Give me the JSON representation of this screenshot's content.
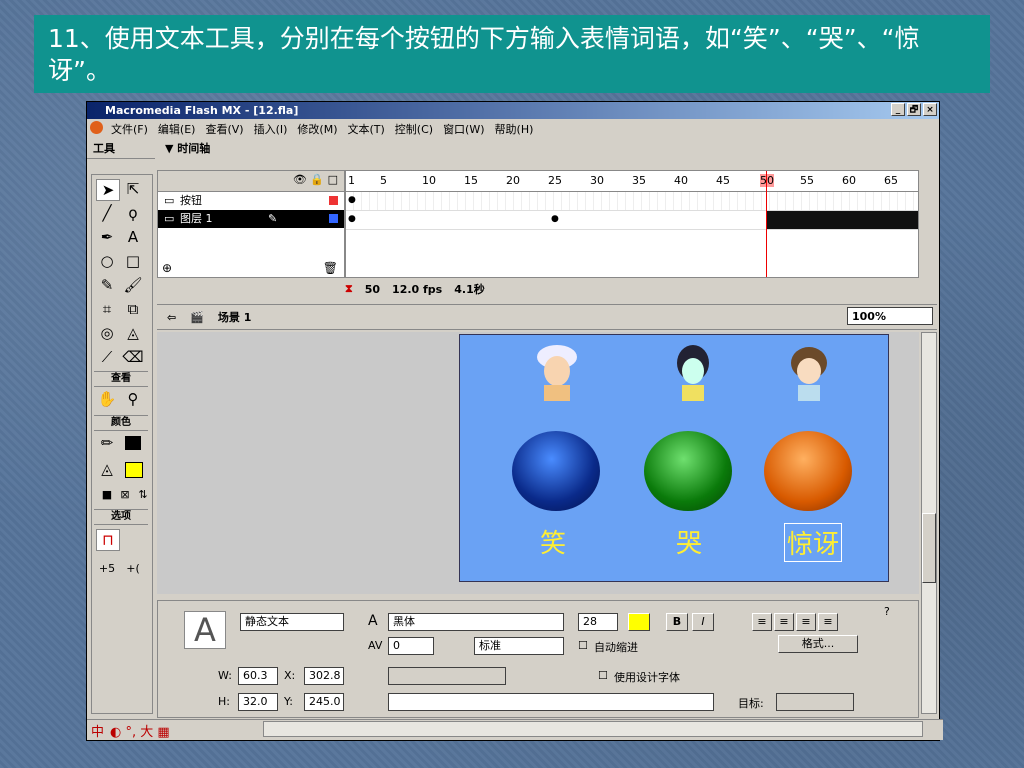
{
  "slide": {
    "title": "11、使用文本工具，分别在每个按钮的下方输入表情词语，如“笑”、“哭”、“惊讶”。"
  },
  "window": {
    "title": "Macromedia Flash MX - [12.fla]",
    "controls": [
      "_",
      "🗗",
      "×"
    ]
  },
  "menu": [
    "文件(F)",
    "编辑(E)",
    "查看(V)",
    "插入(I)",
    "修改(M)",
    "文本(T)",
    "控制(C)",
    "窗口(W)",
    "帮助(H)"
  ],
  "tools": {
    "header": "工具",
    "sections": {
      "view": "查看",
      "colors": "颜色",
      "options": "选项"
    }
  },
  "timeline": {
    "header": "▼ 时间轴",
    "ruler": [
      "1",
      "5",
      "10",
      "15",
      "20",
      "25",
      "30",
      "35",
      "40",
      "45",
      "50",
      "55",
      "60",
      "65"
    ],
    "layers": [
      {
        "name": "按钮"
      },
      {
        "name": "图层 1"
      }
    ],
    "current_frame": "50",
    "fps": "12.0 fps",
    "time": "4.1秒"
  },
  "scene": {
    "name": "场景 1",
    "zoom": "100%"
  },
  "stage": {
    "labels": [
      "笑",
      "哭",
      "惊讶"
    ]
  },
  "properties": {
    "text_type": "静态文本",
    "font": "黑体",
    "size": "28",
    "kerning": "0",
    "char_position": "标准",
    "auto_kern": "自动缩进",
    "format_button": "格式...",
    "use_device_fonts": "使用设计字体",
    "target_label": "目标:",
    "w_label": "W:",
    "w": "60.3",
    "h_label": "H:",
    "h": "32.0",
    "x_label": "X:",
    "x": "302.8",
    "y_label": "Y:",
    "y": "245.0"
  },
  "status": {
    "ime": "中"
  }
}
